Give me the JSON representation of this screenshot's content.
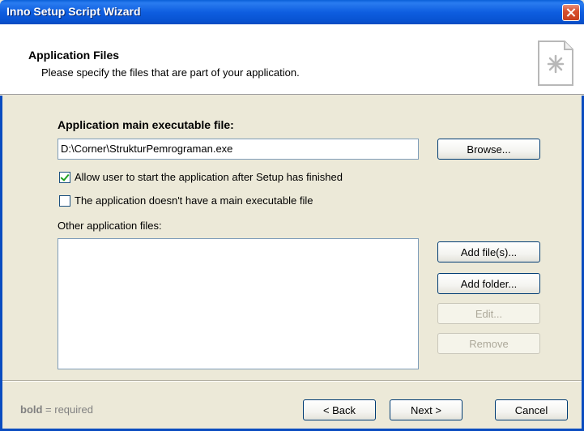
{
  "window": {
    "title": "Inno Setup Script Wizard"
  },
  "header": {
    "title": "Application Files",
    "subtitle": "Please specify the files that are part of your application."
  },
  "main_exe": {
    "label": "Application main executable file:",
    "value": "D:\\Corner\\StrukturPemrograman.exe",
    "browse_label": "Browse..."
  },
  "options": {
    "allow_start": {
      "label": "Allow user to start the application after Setup has finished",
      "checked": true
    },
    "no_exe": {
      "label": "The application doesn't have a main executable file",
      "checked": false
    }
  },
  "other_files": {
    "label": "Other application files:",
    "items": [],
    "add_files_label": "Add file(s)...",
    "add_folder_label": "Add folder...",
    "edit_label": "Edit...",
    "remove_label": "Remove"
  },
  "footer": {
    "bold_word": "bold",
    "required_text": " = required",
    "back_label": "< Back",
    "next_label": "Next >",
    "cancel_label": "Cancel"
  }
}
